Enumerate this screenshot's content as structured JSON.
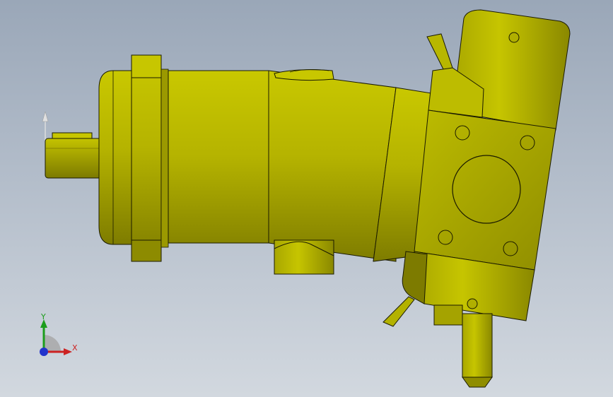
{
  "viewport": {
    "background_top": "#9aa7b8",
    "background_bottom": "#d2d8df"
  },
  "model": {
    "name": "hydraulic-axial-piston-pump",
    "body_color": "#b9b800",
    "shadow_color": "#6a6800",
    "edge_color": "#1a1a00"
  },
  "triad": {
    "x_label": "X",
    "y_label": "Y",
    "x_color": "#cc2222",
    "y_color": "#1c9d1c",
    "z_color": "#2233cc"
  }
}
